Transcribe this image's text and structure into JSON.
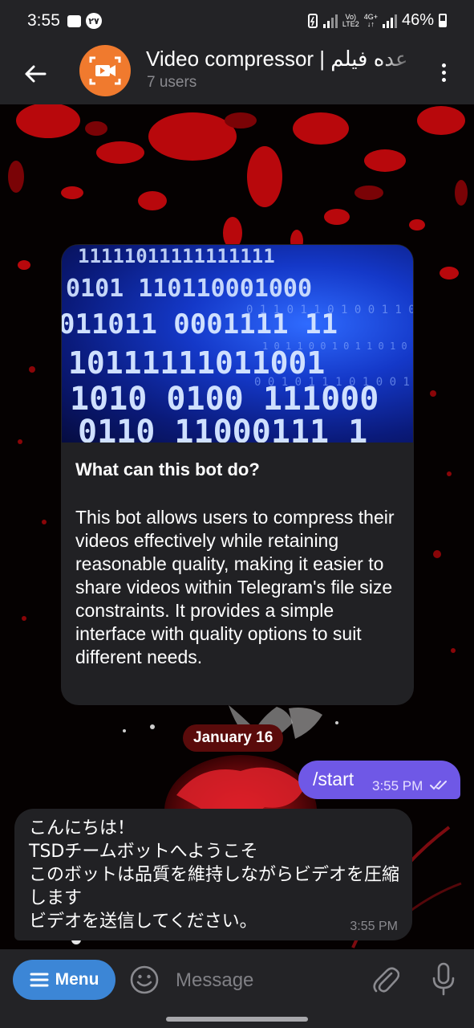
{
  "status_bar": {
    "time": "3:55",
    "badge": "۲۷",
    "net_top": "Vo)",
    "net_bottom": "LTE2",
    "net2_top": "4G+",
    "net2_bottom": "↓↑",
    "battery": "46%"
  },
  "header": {
    "title": "Video compressor | ﻋﺪه ﻓﯿﻠﻢ",
    "subtitle": "7 users",
    "avatar_color": "#f07a2e"
  },
  "bot_card": {
    "heading": "What can this bot do?",
    "description": "This bot allows users to compress their videos effectively while retaining reasonable quality, making it easier to share videos within Telegram's file size constraints. It provides a simple interface with quality options to suit different needs."
  },
  "date_chip": "January 16",
  "outgoing": {
    "text": "/start",
    "time": "3:55 PM"
  },
  "incoming": {
    "text": "こんにちは！\nTSDチームボットへようこそ\nこのボットは品質を維持しながらビデオを圧縮します\nビデオを送信してください。",
    "time": "3:55 PM"
  },
  "input_bar": {
    "menu_label": "Menu",
    "placeholder": "Message"
  },
  "colors": {
    "accent": "#6f58e6",
    "menu_button": "#3c86d6",
    "date_chip": "#5a0b0b",
    "bubble": "#212124"
  },
  "icons": [
    "back-arrow-icon",
    "video-camera-icon",
    "more-vert-icon",
    "hamburger-icon",
    "emoji-icon",
    "attach-icon",
    "mic-icon",
    "double-check-icon"
  ]
}
